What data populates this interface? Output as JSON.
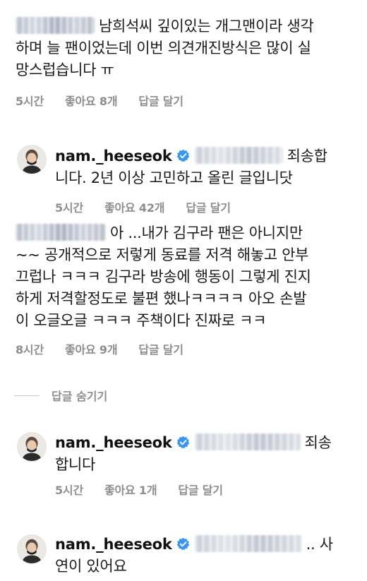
{
  "comments": [
    {
      "text": "남희석씨 깊이있는 개그맨이라 생각하며 늘 팬이었는데 이번 의견개진방식은 많이 실망스럽습니다 ㅠ",
      "lines": [
        "남희석씨 깊이있는 개그맨이라 생각",
        "하며 늘 팬이었는데 이번 의견개진방식은 많이 실",
        "망스럽습니다 ㅠ"
      ],
      "time": "5시간",
      "likes": "좋아요 8개",
      "reply": "답글 달기"
    },
    {
      "username": "nam._heeseok",
      "lines": [
        "죄송합",
        "니다. 2년 이상 고민하고 올린  글입니닷"
      ],
      "time": "5시간",
      "likes": "좋아요 42개",
      "reply": "답글 달기"
    },
    {
      "lines": [
        "아 ...내가 김구라 팬은 아니지만",
        "~~ 공개적으로 저렇게 동료를 저격 해놓고 안부",
        "끄럽나 ㅋㅋㅋ 김구라 방송에 행동이 그렇게 진지",
        "하게 저격할정도로 불편 했나ㅋㅋㅋㅋ 아오 손발",
        "이 오글오글 ㅋㅋㅋ 주책이다 진짜로 ㅋㅋ"
      ],
      "time": "8시간",
      "likes": "좋아요 9개",
      "reply": "답글 달기"
    },
    {
      "username": "nam._heeseok",
      "lines": [
        "죄송",
        "합니다"
      ],
      "time": "5시간",
      "likes": "좋아요 1개",
      "reply": "답글 달기"
    },
    {
      "username": "nam._heeseok",
      "lines": [
        ".. 사",
        "연이 있어요"
      ]
    }
  ],
  "hide_replies_label": "답글 숨기기",
  "colors": {
    "verified": "#3897f0",
    "meta": "#8e8e8e"
  }
}
